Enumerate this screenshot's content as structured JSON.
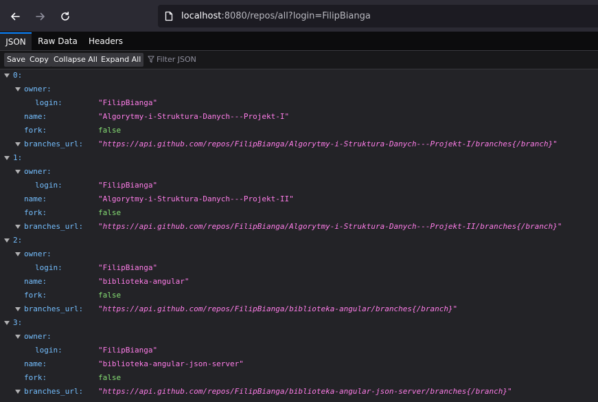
{
  "address_bar": {
    "host": "localhost",
    "rest": ":8080/repos/all?login=FilipBianga"
  },
  "tabs": [
    "JSON",
    "Raw Data",
    "Headers"
  ],
  "toolbar": {
    "save": "Save",
    "copy": "Copy",
    "collapse_all": "Collapse All",
    "expand_all": "Expand All",
    "filter_placeholder": "Filter JSON"
  },
  "keys": {
    "owner": "owner:",
    "login": "login:",
    "name": "name:",
    "fork": "fork:",
    "branches_url": "branches_url:"
  },
  "repos": [
    {
      "index": "0:",
      "login": "\"FilipBianga\"",
      "name": "\"Algorytmy-i-Struktura-Danych---Projekt-I\"",
      "fork": "false",
      "branches_url": "\"https://api.github.com/repos/FilipBianga/Algorytmy-i-Struktura-Danych---Projekt-I/branches{/branch}\""
    },
    {
      "index": "1:",
      "login": "\"FilipBianga\"",
      "name": "\"Algorytmy-i-Struktura-Danych---Projekt-II\"",
      "fork": "false",
      "branches_url": "\"https://api.github.com/repos/FilipBianga/Algorytmy-i-Struktura-Danych---Projekt-II/branches{/branch}\""
    },
    {
      "index": "2:",
      "login": "\"FilipBianga\"",
      "name": "\"biblioteka-angular\"",
      "fork": "false",
      "branches_url": "\"https://api.github.com/repos/FilipBianga/biblioteka-angular/branches{/branch}\""
    },
    {
      "index": "3:",
      "login": "\"FilipBianga\"",
      "name": "\"biblioteka-angular-json-server\"",
      "fork": "false",
      "branches_url": "\"https://api.github.com/repos/FilipBianga/biblioteka-angular-json-server/branches{/branch}\""
    }
  ]
}
